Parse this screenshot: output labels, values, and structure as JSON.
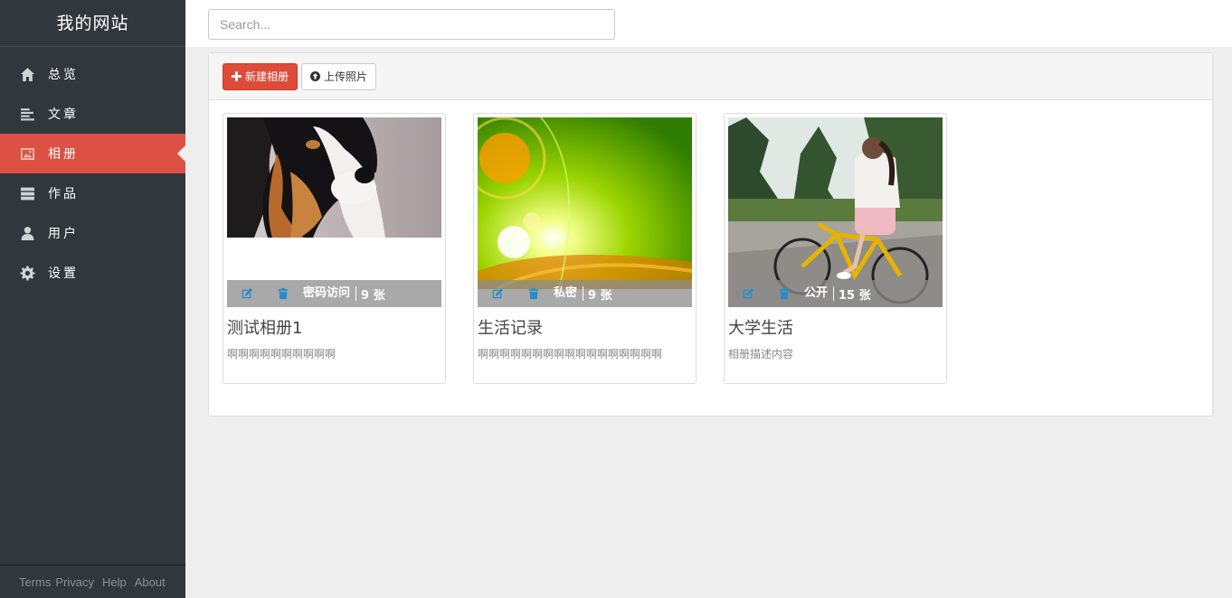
{
  "brand": "我的网站",
  "nav": [
    {
      "label": "总览",
      "icon": "home-icon",
      "active": false
    },
    {
      "label": "文章",
      "icon": "article-icon",
      "active": false
    },
    {
      "label": "相册",
      "icon": "image-icon",
      "active": true
    },
    {
      "label": "作品",
      "icon": "server-icon",
      "active": false
    },
    {
      "label": "用户",
      "icon": "user-icon",
      "active": false
    },
    {
      "label": "设置",
      "icon": "gear-icon",
      "active": false
    }
  ],
  "footer": [
    "Terms",
    "Privacy",
    "Help",
    "About"
  ],
  "search": {
    "placeholder": "Search..."
  },
  "toolbar": {
    "new_album": "新建相册",
    "upload": "上传照片"
  },
  "albums": [
    {
      "title": "测试相册1",
      "description": "啊啊啊啊啊啊啊啊啊啊",
      "access": "密码访问",
      "count": "9 张",
      "image": "dog photo"
    },
    {
      "title": "生活记录",
      "description": "啊啊啊啊啊啊啊啊啊啊啊啊啊啊啊啊啊",
      "access": "私密",
      "count": "9 张",
      "image": "green abstract light"
    },
    {
      "title": "大学生活",
      "description": "相册描述内容",
      "access": "公开",
      "count": "15 张",
      "image": "girl riding yellow bicycle"
    }
  ],
  "colors": {
    "sidebar": "#31373c",
    "active": "#dd5044",
    "danger": "#dd4b39",
    "icon_blue": "#2a8bc9"
  }
}
